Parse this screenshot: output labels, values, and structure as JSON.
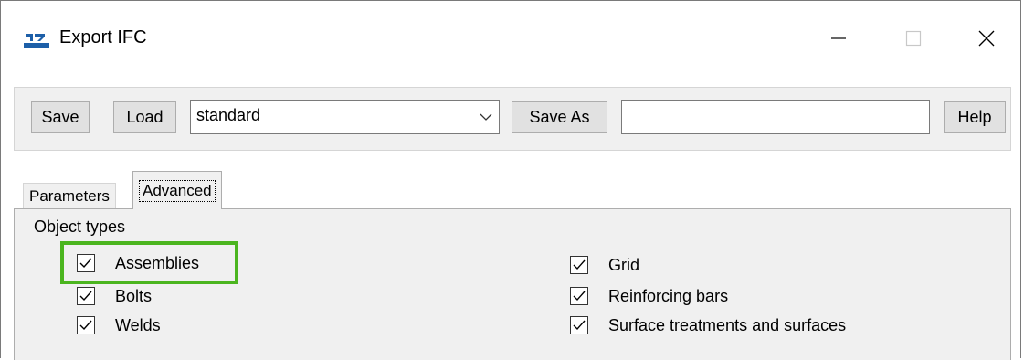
{
  "window": {
    "title": "Export IFC",
    "icon": "ifc-export-app-icon",
    "controls": [
      "minimize-icon",
      "maximize-icon",
      "close-icon"
    ]
  },
  "toolbar": {
    "save_label": "Save",
    "load_label": "Load",
    "preset_value": "standard",
    "save_as_label": "Save As",
    "save_as_name_value": "",
    "help_label": "Help"
  },
  "tabs": [
    {
      "label": "Parameters",
      "active": false
    },
    {
      "label": "Advanced",
      "active": true
    }
  ],
  "object_types": {
    "label": "Object types",
    "left": [
      {
        "label": "Assemblies",
        "checked": true,
        "highlighted": true
      },
      {
        "label": "Bolts",
        "checked": true
      },
      {
        "label": "Welds",
        "checked": true
      }
    ],
    "right": [
      {
        "label": "Grid",
        "checked": true
      },
      {
        "label": "Reinforcing bars",
        "checked": true
      },
      {
        "label": "Surface treatments and surfaces",
        "checked": true
      }
    ]
  },
  "colors": {
    "highlight": "#4bb51f",
    "panel_background": "#f0f0f0",
    "button_background": "#e1e1e1"
  }
}
